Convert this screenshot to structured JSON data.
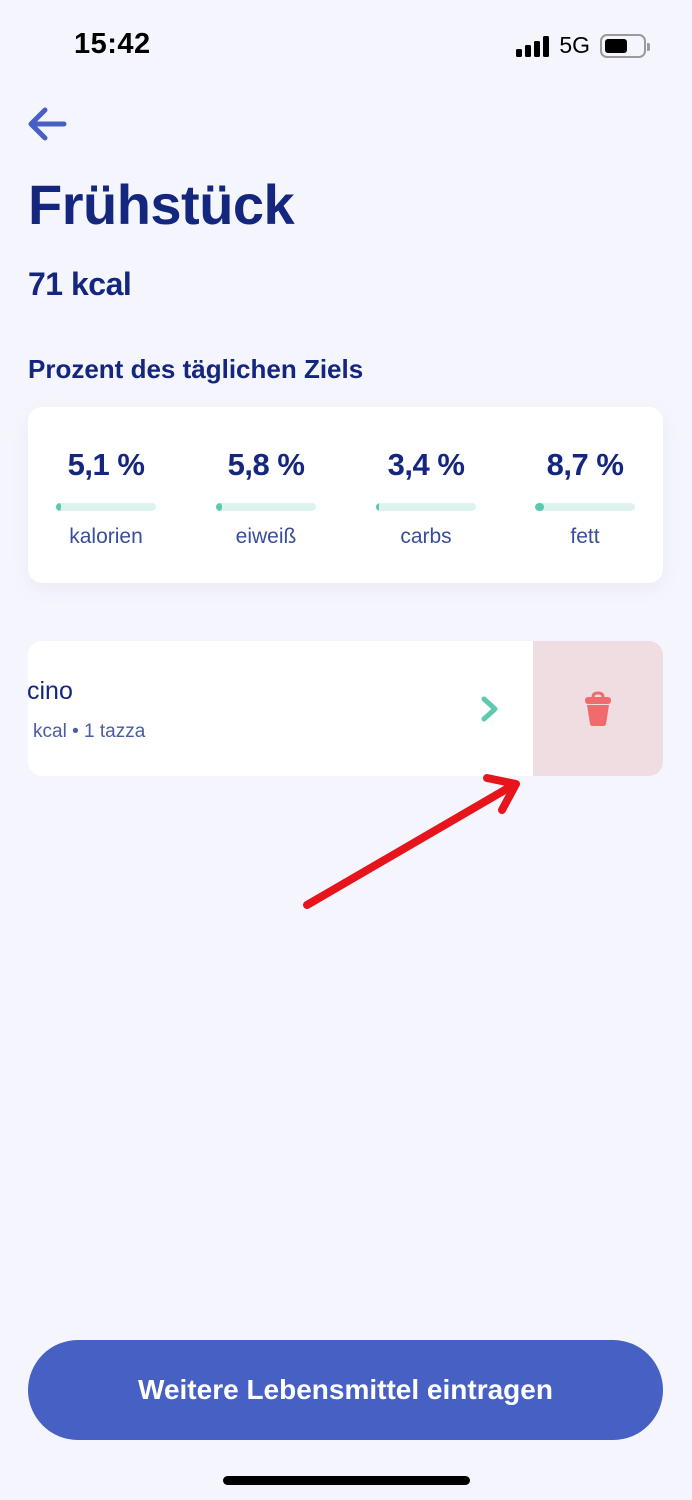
{
  "status": {
    "time": "15:42",
    "network": "5G"
  },
  "header": {
    "title": "Frühstück",
    "kcal": "71 kcal"
  },
  "goals": {
    "section_title": "Prozent des täglichen Ziels",
    "items": [
      {
        "value": "5,1 %",
        "label": "kalorien",
        "fraction": 0.051
      },
      {
        "value": "5,8 %",
        "label": "eiweiß",
        "fraction": 0.058
      },
      {
        "value": "3,4 %",
        "label": "carbs",
        "fraction": 0.034
      },
      {
        "value": "8,7 %",
        "label": "fett",
        "fraction": 0.087
      }
    ]
  },
  "food_items": [
    {
      "name": "cino",
      "detail": "kcal • 1 tazza"
    }
  ],
  "cta": {
    "label": "Weitere Lebensmittel eintragen"
  },
  "colors": {
    "primary": "#4660c4",
    "title": "#14267e",
    "accent_green": "#5ccab0",
    "delete_bg": "#f0dde2",
    "delete_icon": "#ee6b6e",
    "annotation": "#e8141b"
  }
}
